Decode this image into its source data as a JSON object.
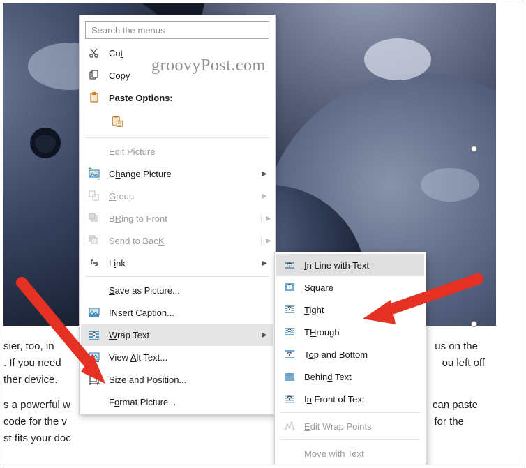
{
  "watermark": "groovyPost.com",
  "search": {
    "placeholder": "Search the menus"
  },
  "menu": {
    "cut": "Cut",
    "copy": "Copy",
    "paste_options": "Paste Options:",
    "edit_picture": "Edit Picture",
    "change_picture": "Change Picture",
    "group": "Group",
    "bring_front": "Bring to Front",
    "send_back": "Send to Back",
    "link": "Link",
    "save_as_picture": "Save as Picture...",
    "insert_caption": "Insert Caption...",
    "wrap_text": "Wrap Text",
    "view_alt": "View Alt Text...",
    "size_position": "Size and Position...",
    "format_picture": "Format Picture..."
  },
  "submenu": {
    "in_line": "In Line with Text",
    "square": "Square",
    "tight": "Tight",
    "through": "Through",
    "top_bottom": "Top and Bottom",
    "behind": "Behind Text",
    "in_front": "In Front of Text",
    "edit_wrap_points": "Edit Wrap Points",
    "move_with_text": "Move with Text"
  },
  "body_text": {
    "p1a": "sier, too, in",
    "p1b": "us on the",
    "p2a": ". If you need",
    "p2b": "ou left off",
    "p3a": "ther device.",
    "p4a": "s a powerful w",
    "p4b": "can paste",
    "p5a": "code for the v",
    "p5b": "for the",
    "p6a": "st fits your doc"
  },
  "accel": {
    "cut": "t",
    "copy": "C",
    "edit": "E",
    "change": "h",
    "group": "G",
    "bring": "R",
    "send": "K",
    "link": "i",
    "save": "S",
    "caption": "N",
    "wrap": "W",
    "alt": "A",
    "size": "z",
    "format": "o",
    "inline": "I",
    "square": "S",
    "tight": "T",
    "through": "H",
    "topbottom": "o",
    "behind": "d",
    "infront": "n",
    "editwrap": "E",
    "movewith": "M"
  }
}
